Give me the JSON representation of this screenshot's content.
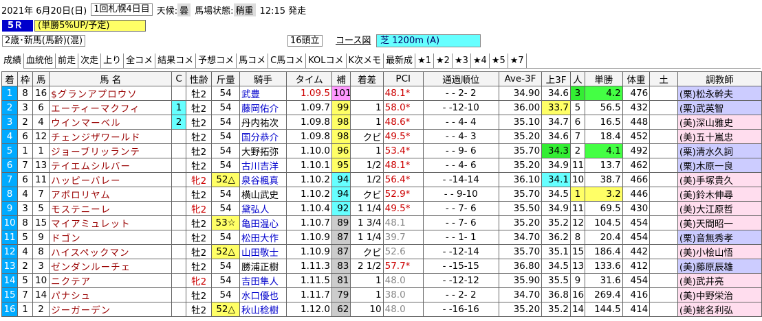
{
  "header": {
    "date": "2021年 6月20日(日)",
    "meeting": "1回札幌4日目",
    "weather_label": "天候:",
    "weather": "曇",
    "track_label": "馬場状態:",
    "track": "稍重",
    "post_time": "12:15 発走"
  },
  "race": {
    "number": "5Ｒ",
    "promo": "(単勝5%UP/予定)",
    "condition": "2歳･新馬(馬齢)(混)",
    "heads": "16頭立",
    "course_link": "コース図",
    "course": "芝 1200m (A)"
  },
  "tabs": [
    "成績",
    "血統他",
    "前走",
    "次走",
    "上り",
    "全コメ",
    "結果コメ",
    "予想コメ",
    "馬コメ",
    "C馬コメ",
    "KOLコメ",
    "K次メモ",
    "最新成",
    "★1",
    "★2",
    "★3",
    "★4",
    "★5",
    "★7"
  ],
  "columns": [
    "着",
    "枠",
    "馬",
    "馬 名",
    "C",
    "性齢",
    "斤量",
    "騎手",
    "タイム",
    "補",
    "着差",
    "PCI",
    "通過順位",
    "Ave-3F",
    "上3F",
    "人",
    "単勝",
    "体重",
    "土",
    "調教師"
  ],
  "rows": [
    {
      "pos": "1",
      "waku": "8",
      "num": "16",
      "name": "$グランアプロウソ",
      "c": "",
      "sexage": "牡2",
      "weight": "54",
      "jockey": "武豊",
      "time": "1.09.5",
      "ho": "101",
      "margin": "",
      "pci": "48.1*",
      "pass": "-  -  2-  2",
      "ave3f": "34.90",
      "last3f": "34.6",
      "pop": "3",
      "odds": "4.2",
      "bw": "476",
      "do": "",
      "trainer": "(栗)松永幹夫"
    },
    {
      "pos": "2",
      "waku": "3",
      "num": "6",
      "name": "エーティーマクフィ",
      "c": "1",
      "sexage": "牡2",
      "weight": "54",
      "jockey": "藤岡佑介",
      "time": "1.09.7",
      "ho": "99",
      "margin": "1",
      "pci": "58.0*",
      "pass": "-  -12-10",
      "ave3f": "36.00",
      "last3f": "33.7",
      "pop": "5",
      "odds": "56.5",
      "bw": "432",
      "do": "",
      "trainer": "(栗)武英智"
    },
    {
      "pos": "3",
      "waku": "2",
      "num": "4",
      "name": "ウインマーベル",
      "c": "2",
      "sexage": "牡2",
      "weight": "54",
      "jockey": "丹内祐次",
      "time": "1.09.8",
      "ho": "98",
      "margin": "1",
      "pci": "48.6*",
      "pass": "-  -  4-  4",
      "ave3f": "35.10",
      "last3f": "34.7",
      "pop": "6",
      "odds": "16.5",
      "bw": "448",
      "do": "",
      "trainer": "(美)深山雅史"
    },
    {
      "pos": "4",
      "waku": "6",
      "num": "12",
      "name": "チェンジザワールド",
      "c": "",
      "sexage": "牡2",
      "weight": "54",
      "jockey": "国分恭介",
      "time": "1.09.8",
      "ho": "98",
      "margin": "クビ",
      "pci": "49.5*",
      "pass": "-  -  4-  3",
      "ave3f": "35.20",
      "last3f": "34.6",
      "pop": "7",
      "odds": "18.4",
      "bw": "452",
      "do": "",
      "trainer": "(美)五十嵐忠"
    },
    {
      "pos": "5",
      "waku": "1",
      "num": "1",
      "name": "ジョーブリッランテ",
      "c": "",
      "sexage": "牡2",
      "weight": "54",
      "jockey": "大野拓弥",
      "time": "1.10.0",
      "ho": "96",
      "margin": "1",
      "pci": "53.4*",
      "pass": "-  -  9-  6",
      "ave3f": "35.70",
      "last3f": "34.3",
      "pop": "2",
      "odds": "4.1",
      "bw": "492",
      "do": "",
      "trainer": "(栗)清水久詞"
    },
    {
      "pos": "6",
      "waku": "7",
      "num": "13",
      "name": "テイエムシルバー",
      "c": "",
      "sexage": "牡2",
      "weight": "54",
      "jockey": "古川吉洋",
      "time": "1.10.1",
      "ho": "95",
      "margin": "1/2",
      "pci": "48.1*",
      "pass": "-  -  4-  6",
      "ave3f": "35.20",
      "last3f": "34.9",
      "pop": "11",
      "odds": "13.7",
      "bw": "462",
      "do": "",
      "trainer": "(栗)木原一良"
    },
    {
      "pos": "7",
      "waku": "6",
      "num": "11",
      "name": "ハッピーバレー",
      "c": "",
      "sexage": "牝2",
      "weight": "52△",
      "jockey": "泉谷楓真",
      "time": "1.10.2",
      "ho": "94",
      "margin": "1/2",
      "pci": "56.4*",
      "pass": "-  -14-14",
      "ave3f": "36.10",
      "last3f": "34.1",
      "pop": "10",
      "odds": "38.7",
      "bw": "466",
      "do": "",
      "trainer": "(美)手塚貴久"
    },
    {
      "pos": "8",
      "waku": "4",
      "num": "7",
      "name": "アポロリヤム",
      "c": "",
      "sexage": "牡2",
      "weight": "54",
      "jockey": "横山武史",
      "time": "1.10.2",
      "ho": "94",
      "margin": "クビ",
      "pci": "52.9*",
      "pass": "-  -  9-10",
      "ave3f": "35.70",
      "last3f": "34.5",
      "pop": "1",
      "odds": "3.2",
      "bw": "446",
      "do": "",
      "trainer": "(美)鈴木伸尋"
    },
    {
      "pos": "9",
      "waku": "3",
      "num": "5",
      "name": "モステニーレ",
      "c": "",
      "sexage": "牝2",
      "weight": "54",
      "jockey": "黛弘人",
      "time": "1.10.4",
      "ho": "92",
      "margin": "1 1/4",
      "pci": "49.5*",
      "pass": "-  -  7-  6",
      "ave3f": "35.50",
      "last3f": "34.9",
      "pop": "11",
      "odds": "69.5",
      "bw": "430",
      "do": "",
      "trainer": "(美)大江原哲"
    },
    {
      "pos": "10",
      "waku": "8",
      "num": "15",
      "name": "マイアミュレット",
      "c": "",
      "sexage": "牡2",
      "weight": "53☆",
      "jockey": "亀田温心",
      "time": "1.10.7",
      "ho": "89",
      "margin": "1 3/4",
      "pci": "48.1",
      "pass": "-  -  7-  6",
      "ave3f": "35.20",
      "last3f": "35.2",
      "pop": "12",
      "odds": "104.5",
      "bw": "454",
      "do": "",
      "trainer": "(美)天間昭一"
    },
    {
      "pos": "11",
      "waku": "5",
      "num": "9",
      "name": "ドゴン",
      "c": "",
      "sexage": "牡2",
      "weight": "54",
      "jockey": "松田大作",
      "time": "1.10.9",
      "ho": "87",
      "margin": "1 1/4",
      "pci": "39.7",
      "pass": "-  -  1-  1",
      "ave3f": "34.70",
      "last3f": "36.2",
      "pop": "8",
      "odds": "20.4",
      "bw": "454",
      "do": "",
      "trainer": "(栗)音無秀孝"
    },
    {
      "pos": "12",
      "waku": "4",
      "num": "8",
      "name": "ハイスペックマン",
      "c": "",
      "sexage": "牡2",
      "weight": "52△",
      "jockey": "山田敬士",
      "time": "1.10.9",
      "ho": "87",
      "margin": "クビ",
      "pci": "52.6",
      "pass": "-  -12-14",
      "ave3f": "35.70",
      "last3f": "35.1",
      "pop": "15",
      "odds": "186.4",
      "bw": "442",
      "do": "",
      "trainer": "(美)小桧山悟"
    },
    {
      "pos": "13",
      "waku": "2",
      "num": "3",
      "name": "ゼンダンルーチェ",
      "c": "",
      "sexage": "牡2",
      "weight": "54",
      "jockey": "勝浦正樹",
      "time": "1.11.3",
      "ho": "83",
      "margin": "2 1/2",
      "pci": "57.7*",
      "pass": "-  -15-15",
      "ave3f": "36.80",
      "last3f": "34.5",
      "pop": "13",
      "odds": "133.6",
      "bw": "412",
      "do": "",
      "trainer": "(美)藤原辰雄"
    },
    {
      "pos": "14",
      "waku": "5",
      "num": "10",
      "name": "ニクテア",
      "c": "",
      "sexage": "牝2",
      "weight": "54",
      "jockey": "吉田隼人",
      "time": "1.11.5",
      "ho": "81",
      "margin": "1",
      "pci": "48.0",
      "pass": "-  -12-12",
      "ave3f": "35.90",
      "last3f": "35.5",
      "pop": "9",
      "odds": "31.6",
      "bw": "454",
      "do": "",
      "trainer": "(美)武井亮"
    },
    {
      "pos": "15",
      "waku": "7",
      "num": "14",
      "name": "パナシュ",
      "c": "",
      "sexage": "牡2",
      "weight": "54",
      "jockey": "水口優也",
      "time": "1.11.7",
      "ho": "79",
      "margin": "1",
      "pci": "38.0",
      "pass": "-  -  2-  2",
      "ave3f": "34.70",
      "last3f": "36.8",
      "pop": "16",
      "odds": "269.4",
      "bw": "416",
      "do": "",
      "trainer": "(美)中野栄治"
    },
    {
      "pos": "16",
      "waku": "1",
      "num": "2",
      "name": "ジーガーデン",
      "c": "",
      "sexage": "牡2",
      "weight": "52△",
      "jockey": "秋山稔樹",
      "time": "1.12.0",
      "ho": "62",
      "margin": "10",
      "pci": "48.0",
      "pass": "-  -16-16",
      "ave3f": "35.20",
      "last3f": "35.2",
      "pop": "14",
      "odds": "144.5",
      "bw": "414",
      "do": "",
      "trainer": "(美)蛯名利弘"
    }
  ],
  "colors": {
    "race_num_bg": "#0000cc",
    "promo_bg": "#ffff66",
    "pos_bg": "#00aaff",
    "hi_yellow": "#ffff66",
    "green": "#33ee33",
    "aqua": "#66ffff",
    "pink": "#ff99ff",
    "trainer_east": "#ffddee",
    "trainer_west": "#ccccff"
  }
}
